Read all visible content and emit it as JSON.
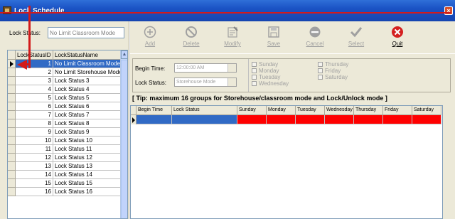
{
  "window": {
    "title": "Lock Schedule",
    "close_symbol": "×"
  },
  "left": {
    "lock_status_label": "Lock Status:",
    "lock_status_value": "No Limit Classroom Mode",
    "grid": {
      "columns": [
        "LockStatusID",
        "LockStatusName"
      ],
      "rows": [
        {
          "id": "1",
          "name": "No Limit Classroom Mode"
        },
        {
          "id": "2",
          "name": "No Limit Storehouse Mode"
        },
        {
          "id": "3",
          "name": "Lock Status 3"
        },
        {
          "id": "4",
          "name": "Lock Status 4"
        },
        {
          "id": "5",
          "name": "Lock Status 5"
        },
        {
          "id": "6",
          "name": "Lock Status 6"
        },
        {
          "id": "7",
          "name": "Lock Status 7"
        },
        {
          "id": "8",
          "name": "Lock Status 8"
        },
        {
          "id": "9",
          "name": "Lock Status 9"
        },
        {
          "id": "10",
          "name": "Lock Status 10"
        },
        {
          "id": "11",
          "name": "Lock Status 11"
        },
        {
          "id": "12",
          "name": "Lock Status 12"
        },
        {
          "id": "13",
          "name": "Lock Status 13"
        },
        {
          "id": "14",
          "name": "Lock Status 14"
        },
        {
          "id": "15",
          "name": "Lock Status 15"
        },
        {
          "id": "16",
          "name": "Lock Status 16"
        }
      ],
      "scroll_up_symbol": "▲"
    }
  },
  "toolbar": {
    "add": "Add",
    "delete": "Delete",
    "modify": "Modify",
    "save": "Save",
    "cancel": "Cancel",
    "select": "Select",
    "quit": "Quit"
  },
  "form": {
    "begin_time_label": "Begin Time:",
    "begin_time_value": "12:00:00 AM",
    "lock_status_label": "Lock Status:",
    "lock_status_value": "Storehouse Mode",
    "days_left": [
      "Sunday",
      "Monday",
      "Tuesday",
      "Wednesday"
    ],
    "days_right": [
      "Thursday",
      "Friday",
      "Saturday"
    ]
  },
  "tip": "[ Tip: maximum 16 groups for Storehouse/classroom mode and Lock/Unlock mode ]",
  "schedule_grid": {
    "columns": [
      "Begin Time",
      "Lock Status",
      "Sunday",
      "Monday",
      "Tuesday",
      "Wednesday",
      "Thursday",
      "Friday",
      "Saturday"
    ]
  },
  "colors": {
    "selection": "#316ac5",
    "day_cells": "#ff0000",
    "annotation": "#d21a1a",
    "quit_icon": "#d42020"
  }
}
